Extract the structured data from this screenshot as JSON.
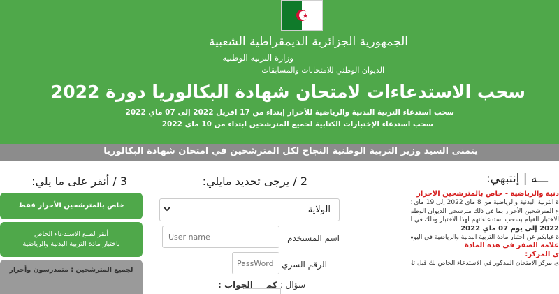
{
  "header": {
    "republic": "الجمهورية الجزائرية الديمقراطية الشعبية",
    "ministry": "وزارة التربية الوطنية",
    "office": "الديوان الوطني للامتحانات والمسابقات",
    "main_title": "سحب الاستدعاءات لامتحان شهادة البكالوريا دورة 2022",
    "sub_line_1": "سحب استدعاء التربية البدنية والرياضية للأحرار إبتداء من 17 افريل 2022 إلى 07 ماي 2022",
    "sub_line_2": "سحب استدعاء الإختبارات الكتابية لجميع المترشحين ابتداء من 10 ماي 2022",
    "flag_colors": {
      "green": "#0f7a2a",
      "white": "#ffffff",
      "red": "#d21034"
    },
    "bg_color": "#4fa84a"
  },
  "banner": {
    "text": "يتمنى السيد وزير التربية الوطنية النجاح لكل المترشحين في امتحان شهادة البكالوريا"
  },
  "notice": {
    "title": "ـــه | إنتبهي:",
    "lines": [
      {
        "text": "دنية والرياضية - خاص بالمترشحين الأحرار",
        "style": "red"
      },
      {
        "text": "ة التربية البدنية والرياضية من 8 ماي 2022 إلى 19 ماي 2022",
        "style": "normal"
      },
      {
        "text": "ع المترشحين الأحرار بما في ذلك مترشحي الديوان الوطني للتعليم والتكوين عن بعد",
        "style": "normal"
      },
      {
        "text": "الاختبار القيام بسحب استدعاءاتهم لهذا الاختبار وذلك في الفترة الممتدة من يوم",
        "style": "normal"
      },
      {
        "text": "2022 إلى يوم 07 ماي 2022",
        "style": "bold"
      },
      {
        "text": "ة غيابكم عن اختبار مادة التربية البدنية والرياضية في اليوم المحدد في الاستدعاء",
        "style": "normal"
      },
      {
        "text": "علامة الصفر في هذه المادة",
        "style": "red"
      },
      {
        "text": "ى المركز:",
        "style": "red"
      },
      {
        "text": "ى مركز الامتحان المذكور في الاستدعاء الخاص بك قبل تاريخ الإجراء للتعرف على",
        "style": "normal"
      }
    ]
  },
  "form": {
    "title": "2 / يرجى تحديد مايلي:",
    "wilaya_label": "الولاية",
    "username_label": "اسم المستخدم",
    "username_placeholder": "User name",
    "password_label": "الرقم السري",
    "password_placeholder": "PassWord",
    "captcha_label": "سؤال :",
    "captcha_question": "كم",
    "answer_label": "الجواب :"
  },
  "choices": {
    "title": "3 / أنقر على ما يلي:",
    "free_candidates": "خاص بالمترشحين الأحرار فقط",
    "pe_line_1": "أنقر لطبع الاستدعاء الخاص",
    "pe_line_2": "باختبار مادة التربية البدنية والرياضية",
    "all_candidates": "لجميع المترشحين : متمدرسون وأحرار"
  }
}
